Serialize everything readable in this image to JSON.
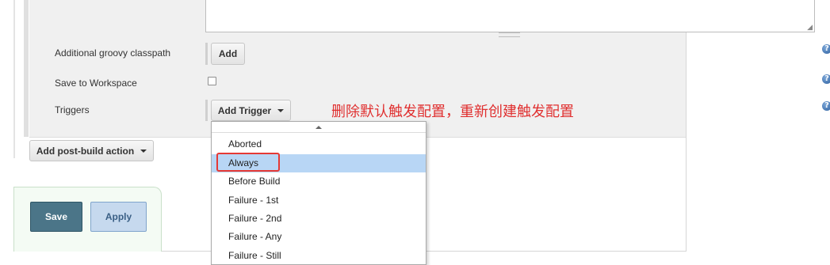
{
  "form": {
    "fields": [
      {
        "label": "Additional groovy classpath",
        "control": "button",
        "button_label": "Add"
      },
      {
        "label": "Save to Workspace",
        "control": "checkbox",
        "checked": false
      },
      {
        "label": "Triggers",
        "control": "dropdown-button",
        "button_label": "Add Trigger"
      }
    ],
    "help_icon_glyph": "?",
    "resize_grip_glyph": "◢",
    "post_build_button_label": "Add post-build action"
  },
  "annotation": {
    "text": "删除默认触发配置，重新创建触发配置",
    "color": "#e03030"
  },
  "actions": {
    "save_label": "Save",
    "apply_label": "Apply"
  },
  "trigger_menu": {
    "items": [
      "Aborted",
      "Always",
      "Before Build",
      "Failure - 1st",
      "Failure - 2nd",
      "Failure - Any",
      "Failure - Still"
    ],
    "highlighted": "Always",
    "highlight_color": "#b8d6f5"
  },
  "colors": {
    "save_button": "#4b7588",
    "apply_button": "#c6d9ee",
    "callout_box": "#e53935"
  }
}
